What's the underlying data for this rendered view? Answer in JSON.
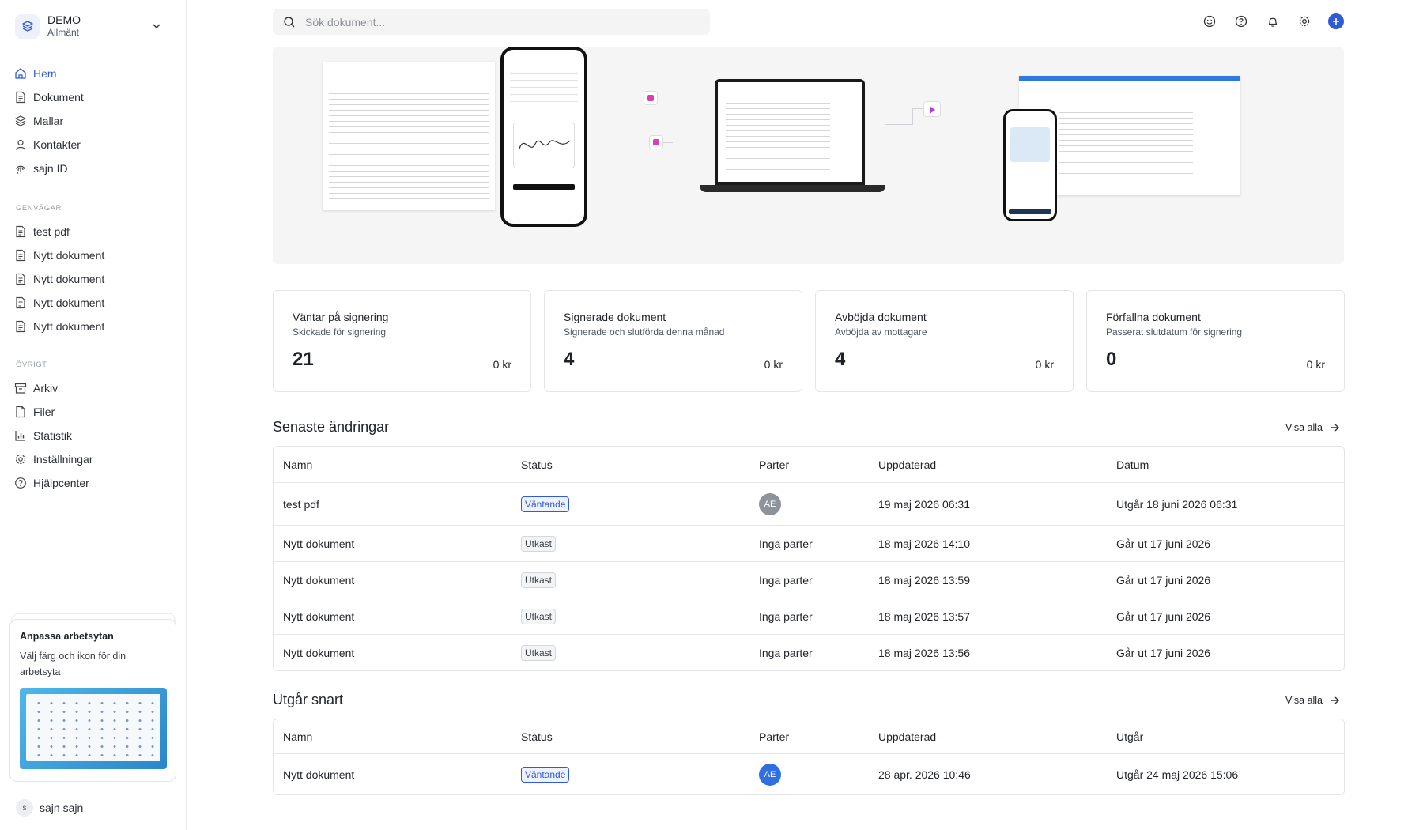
{
  "workspace": {
    "name": "DEMO",
    "subtitle": "Allmänt"
  },
  "nav": [
    {
      "label": "Hem",
      "icon": "home-icon",
      "active": true
    },
    {
      "label": "Dokument",
      "icon": "document-icon"
    },
    {
      "label": "Mallar",
      "icon": "layers-icon"
    },
    {
      "label": "Kontakter",
      "icon": "user-icon"
    },
    {
      "label": "sajn ID",
      "icon": "fingerprint-icon"
    }
  ],
  "shortcuts": {
    "title": "GENVÄGAR",
    "items": [
      "test pdf",
      "Nytt dokument",
      "Nytt dokument",
      "Nytt dokument",
      "Nytt dokument"
    ]
  },
  "other": {
    "title": "ÖVRIGT",
    "items": [
      {
        "label": "Arkiv",
        "icon": "archive-icon"
      },
      {
        "label": "Filer",
        "icon": "file-icon"
      },
      {
        "label": "Statistik",
        "icon": "chart-icon"
      },
      {
        "label": "Inställningar",
        "icon": "gear-icon"
      },
      {
        "label": "Hjälpcenter",
        "icon": "help-icon"
      }
    ]
  },
  "promo": {
    "title": "Anpassa arbetsytan",
    "text": "Välj färg och ikon för din arbetsyta"
  },
  "user": {
    "initial": "s",
    "name": "sajn sajn"
  },
  "search": {
    "placeholder": "Sök dokument..."
  },
  "top_icons": [
    "smiley-icon",
    "help-icon",
    "bell-icon",
    "gear-icon",
    "plus-icon"
  ],
  "stats": [
    {
      "title": "Väntar på signering",
      "subtitle": "Skickade för signering",
      "count": "21",
      "amount": "0 kr"
    },
    {
      "title": "Signerade dokument",
      "subtitle": "Signerade och slutförda denna månad",
      "count": "4",
      "amount": "0 kr"
    },
    {
      "title": "Avböjda dokument",
      "subtitle": "Avböjda av mottagare",
      "count": "4",
      "amount": "0 kr"
    },
    {
      "title": "Förfallna dokument",
      "subtitle": "Passerat slutdatum för signering",
      "count": "0",
      "amount": "0 kr"
    }
  ],
  "recent": {
    "title": "Senaste ändringar",
    "link": "Visa alla",
    "columns": [
      "Namn",
      "Status",
      "Parter",
      "Uppdaterad",
      "Datum"
    ],
    "rows": [
      {
        "name": "test pdf",
        "status": "Väntande",
        "status_type": "pending",
        "parter": "AE",
        "parter_type": "avatar-grey",
        "updated": "19 maj 2026 06:31",
        "date": "Utgår 18 juni 2026 06:31"
      },
      {
        "name": "Nytt dokument",
        "status": "Utkast",
        "status_type": "draft",
        "parter": "Inga parter",
        "parter_type": "text",
        "updated": "18 maj 2026 14:10",
        "date": "Går ut 17 juni 2026"
      },
      {
        "name": "Nytt dokument",
        "status": "Utkast",
        "status_type": "draft",
        "parter": "Inga parter",
        "parter_type": "text",
        "updated": "18 maj 2026 13:59",
        "date": "Går ut 17 juni 2026"
      },
      {
        "name": "Nytt dokument",
        "status": "Utkast",
        "status_type": "draft",
        "parter": "Inga parter",
        "parter_type": "text",
        "updated": "18 maj 2026 13:57",
        "date": "Går ut 17 juni 2026"
      },
      {
        "name": "Nytt dokument",
        "status": "Utkast",
        "status_type": "draft",
        "parter": "Inga parter",
        "parter_type": "text",
        "updated": "18 maj 2026 13:56",
        "date": "Går ut 17 juni 2026"
      }
    ]
  },
  "expiring": {
    "title": "Utgår snart",
    "link": "Visa alla",
    "columns": [
      "Namn",
      "Status",
      "Parter",
      "Uppdaterad",
      "Utgår"
    ],
    "rows": [
      {
        "name": "Nytt dokument",
        "status": "Väntande",
        "status_type": "pending",
        "parter": "AE",
        "parter_type": "avatar-blue",
        "updated": "28 apr. 2026 10:46",
        "date": "Utgår 24 maj 2026 15:06"
      }
    ]
  },
  "colors": {
    "accent": "#2f5ad8",
    "avatar_grey": "#8e939b",
    "avatar_blue": "#2f6fe0"
  }
}
